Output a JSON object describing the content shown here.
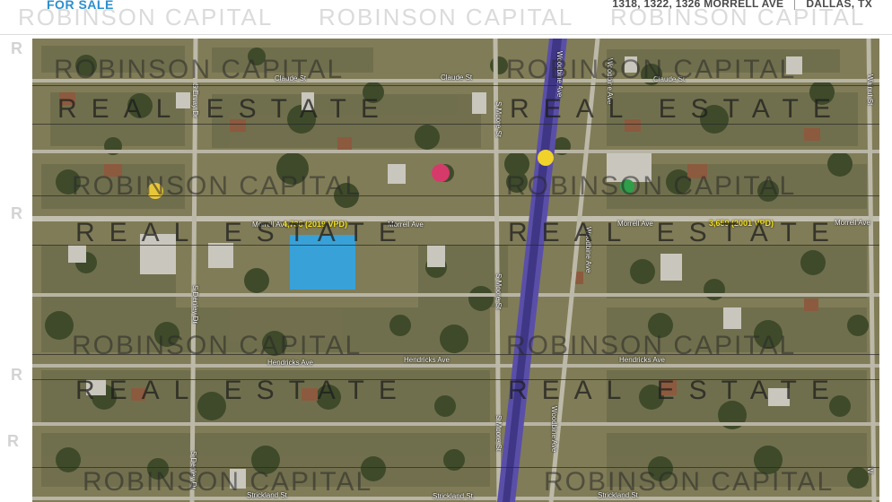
{
  "header": {
    "for_sale": "FOR SALE",
    "address": "1318, 1322, 1326 MORRELL AVE",
    "city": "DALLAS, TX",
    "watermark": "ROBINSON CAPITAL"
  },
  "watermark": {
    "name": "ROBINSON CAPITAL",
    "real_estate": "REAL ESTATE",
    "side_letter": "R"
  },
  "streets": {
    "claude_left": "Claude St",
    "claude_mid": "Claude St",
    "claude_right": "Claude St",
    "morrell_left": "Morrell Ave",
    "morrell_mid": "Morrell Ave",
    "morrell_right1": "Morrell Ave",
    "morrell_right2": "Morrell Ave",
    "hendricks_left": "Hendricks Ave",
    "hendricks_mid": "Hendricks Ave",
    "hendricks_right": "Hendricks Ave",
    "strickland_left": "Strickland St",
    "strickland_mid": "Strickland St",
    "strickland_right": "Strickland St",
    "ervay_top": "S Ervay Dr",
    "denley_mid": "S Denley Dr",
    "denley_bot": "S Denley Dr",
    "moore_top": "S Moore St",
    "moore_mid": "S Moore St",
    "moore_bot": "S Moore St",
    "woodbine_top": "Woodbine Ave",
    "woodbine_mid": "Woodbine Ave",
    "woodbine_bot": "Woodbine Ave",
    "woodbine_right": "Woodbine Ave",
    "walnut": "Walnut St",
    "west": "W"
  },
  "traffic": {
    "west_count": "4,736 (2019 VPD)",
    "east_count": "3,659 (2001 VPD)"
  },
  "colors": {
    "brand_blue": "#2a8fcf",
    "parcel": "#28aaf5",
    "rail": "#5a4fa8",
    "traffic_label": "#f6e21c"
  }
}
